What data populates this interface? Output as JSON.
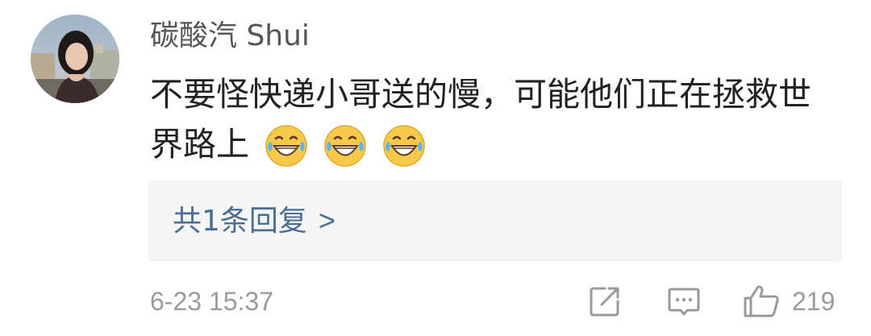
{
  "comment": {
    "username": "碳酸汽 Shui",
    "text": "不要怪快递小哥送的慢，可能他们正在拯救世界路上",
    "emojis": [
      "laughing-crying-emoji",
      "laughing-crying-emoji",
      "laughing-crying-emoji"
    ],
    "timestamp": "6-23 15:37"
  },
  "replies": {
    "label": "共1条回复",
    "arrow": ">"
  },
  "actions": {
    "share_icon": "share-icon",
    "comment_icon": "comment-icon",
    "like_icon": "thumbs-up-icon",
    "like_count": "219"
  },
  "colors": {
    "link": "#4b6e96",
    "meta": "#9a9a9a",
    "reply_bg": "#f5f5f5"
  }
}
